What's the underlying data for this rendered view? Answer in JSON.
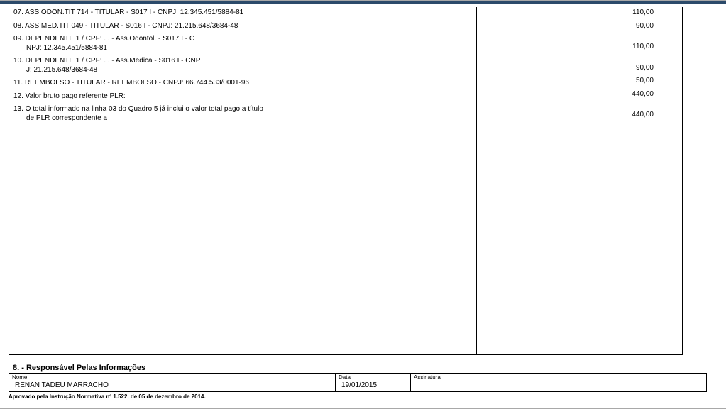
{
  "items": [
    {
      "line1": "07. ASS.ODON.TIT 714           - TITULAR - S017 I - CNPJ: 12.345.451/5884-81",
      "line2": "",
      "value": "110,00"
    },
    {
      "line1": "08. ASS.MED.TIT 049           - TITULAR - S016 I - CNPJ: 21.215.648/3684-48",
      "line2": "",
      "value": "90,00"
    },
    {
      "line1": "09. DEPENDENTE 1           / CPF:  .   .   - Ass.Odontol. - S017 I - C",
      "line2": "NPJ: 12.345.451/5884-81",
      "value": "110,00"
    },
    {
      "line1": "10. DEPENDENTE 1           / CPF:  .   .   - Ass.Medica - S016 I - CNP",
      "line2": "J: 21.215.648/3684-48",
      "value": "90,00"
    },
    {
      "line1": "11. REEMBOLSO            - TITULAR - REEMBOLSO - CNPJ: 66.744.533/0001-96",
      "line2": "",
      "value": "50,00"
    },
    {
      "line1": "12. Valor bruto pago referente PLR:",
      "line2": "",
      "value": "440,00"
    },
    {
      "line1": "13. O total informado na linha 03 do Quadro 5 já inclui o valor total pago a título",
      "line2": "de PLR correspondente a",
      "value": "440,00"
    }
  ],
  "section8": {
    "title": "8. - Responsável Pelas Informações",
    "nome_label": "Nome",
    "nome_value": "RENAN TADEU MARRACHO",
    "data_label": "Data",
    "data_value": "19/01/2015",
    "assinatura_label": "Assinatura"
  },
  "footnote": "Aprovado pela Instrução Normativa nº 1.522, de 05 de dezembro de 2014."
}
